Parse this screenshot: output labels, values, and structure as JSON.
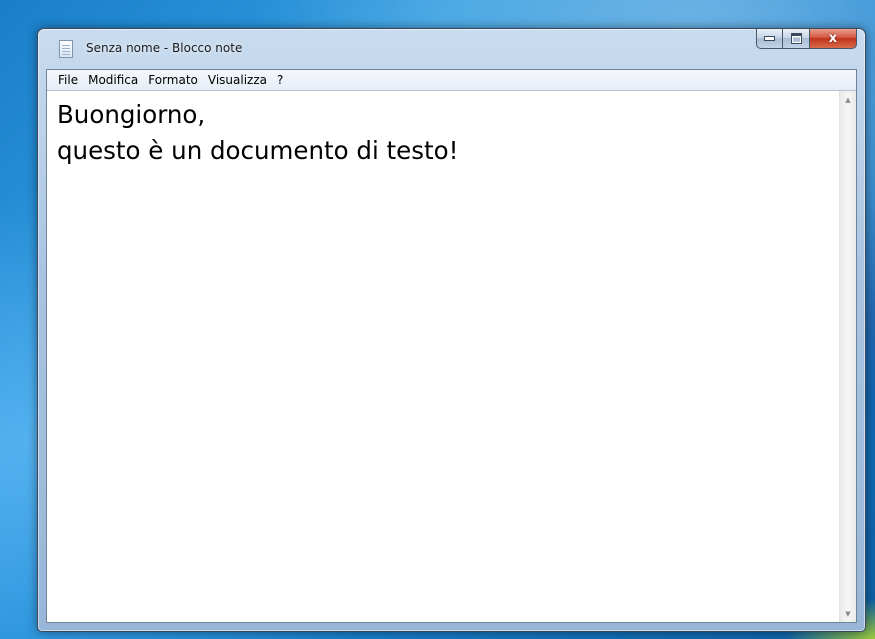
{
  "window": {
    "title": "Senza nome - Blocco note",
    "close_glyph": "x"
  },
  "menubar": {
    "items": [
      "File",
      "Modifica",
      "Formato",
      "Visualizza",
      "?"
    ]
  },
  "editor": {
    "lines": [
      "Buongiorno,",
      "questo è un documento di testo!"
    ]
  },
  "icons": {
    "app": "notepad-icon",
    "minimize": "minimize-icon",
    "maximize": "maximize-icon",
    "close": "close-icon",
    "scroll_up": "scroll-up-arrow-icon",
    "scroll_down": "scroll-down-arrow-icon"
  },
  "colors": {
    "desktop": "#1c86d4",
    "window_frame": "#a9c4e2",
    "close_button": "#c2331c",
    "editor_bg": "#ffffff"
  }
}
